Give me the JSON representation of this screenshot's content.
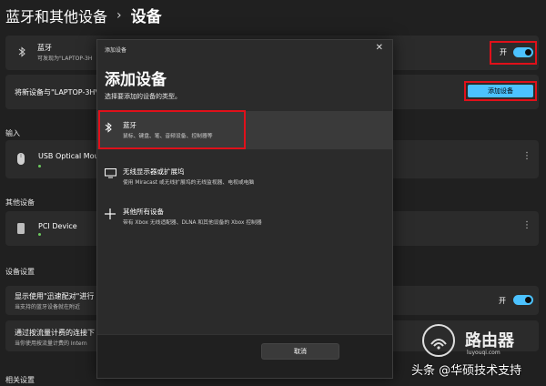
{
  "breadcrumb": {
    "parent": "蓝牙和其他设备",
    "separator": "›",
    "current": "设备"
  },
  "bluetooth_card": {
    "title": "蓝牙",
    "subtitle": "可发现为\"LAPTOP-3H",
    "toggle_label": "开",
    "icon": "bluetooth-icon"
  },
  "pair_card": {
    "title": "将新设备与\"LAPTOP-3HV",
    "button_label": "添加设备"
  },
  "sections": {
    "input": "输入",
    "other_devices": "其他设备",
    "device_settings": "设备设置",
    "related": "相关设置"
  },
  "input_device": {
    "name": "USB Optical Mous",
    "icon": "mouse-icon"
  },
  "other_device": {
    "name": "PCI Device",
    "icon": "device-icon"
  },
  "swift_pair": {
    "title": "显示使用\"迅速配对\"进行",
    "subtitle": "当支持的蓝牙设备就在附近",
    "toggle_label": "开"
  },
  "metered": {
    "title": "通过按流量计费的连接下",
    "subtitle": "当你使用按流量计费的 Intern"
  },
  "dialog": {
    "window_title": "添加设备",
    "close_icon": "close-icon",
    "heading": "添加设备",
    "description": "选择要添加的设备的类型。",
    "options": [
      {
        "title": "蓝牙",
        "desc": "鼠标、键盘、笔、音频设备、控制器等",
        "icon": "bluetooth-icon"
      },
      {
        "title": "无线显示器或扩展坞",
        "desc": "使用 Miracast 或无线扩展坞的无线监视器、电视或电脑",
        "icon": "monitor-icon"
      },
      {
        "title": "其他所有设备",
        "desc": "带有 Xbox 无线适配器、DLNA 和其他设备的 Xbox 控制器",
        "icon": "plus-icon"
      }
    ],
    "cancel_label": "取消"
  },
  "watermark": {
    "brand": "路由器",
    "url": "luyouqi.com",
    "credit": "头条 @华硕技术支持"
  },
  "colors": {
    "accent": "#4cc2ff",
    "highlight": "#e0101a",
    "background": "#202020"
  }
}
